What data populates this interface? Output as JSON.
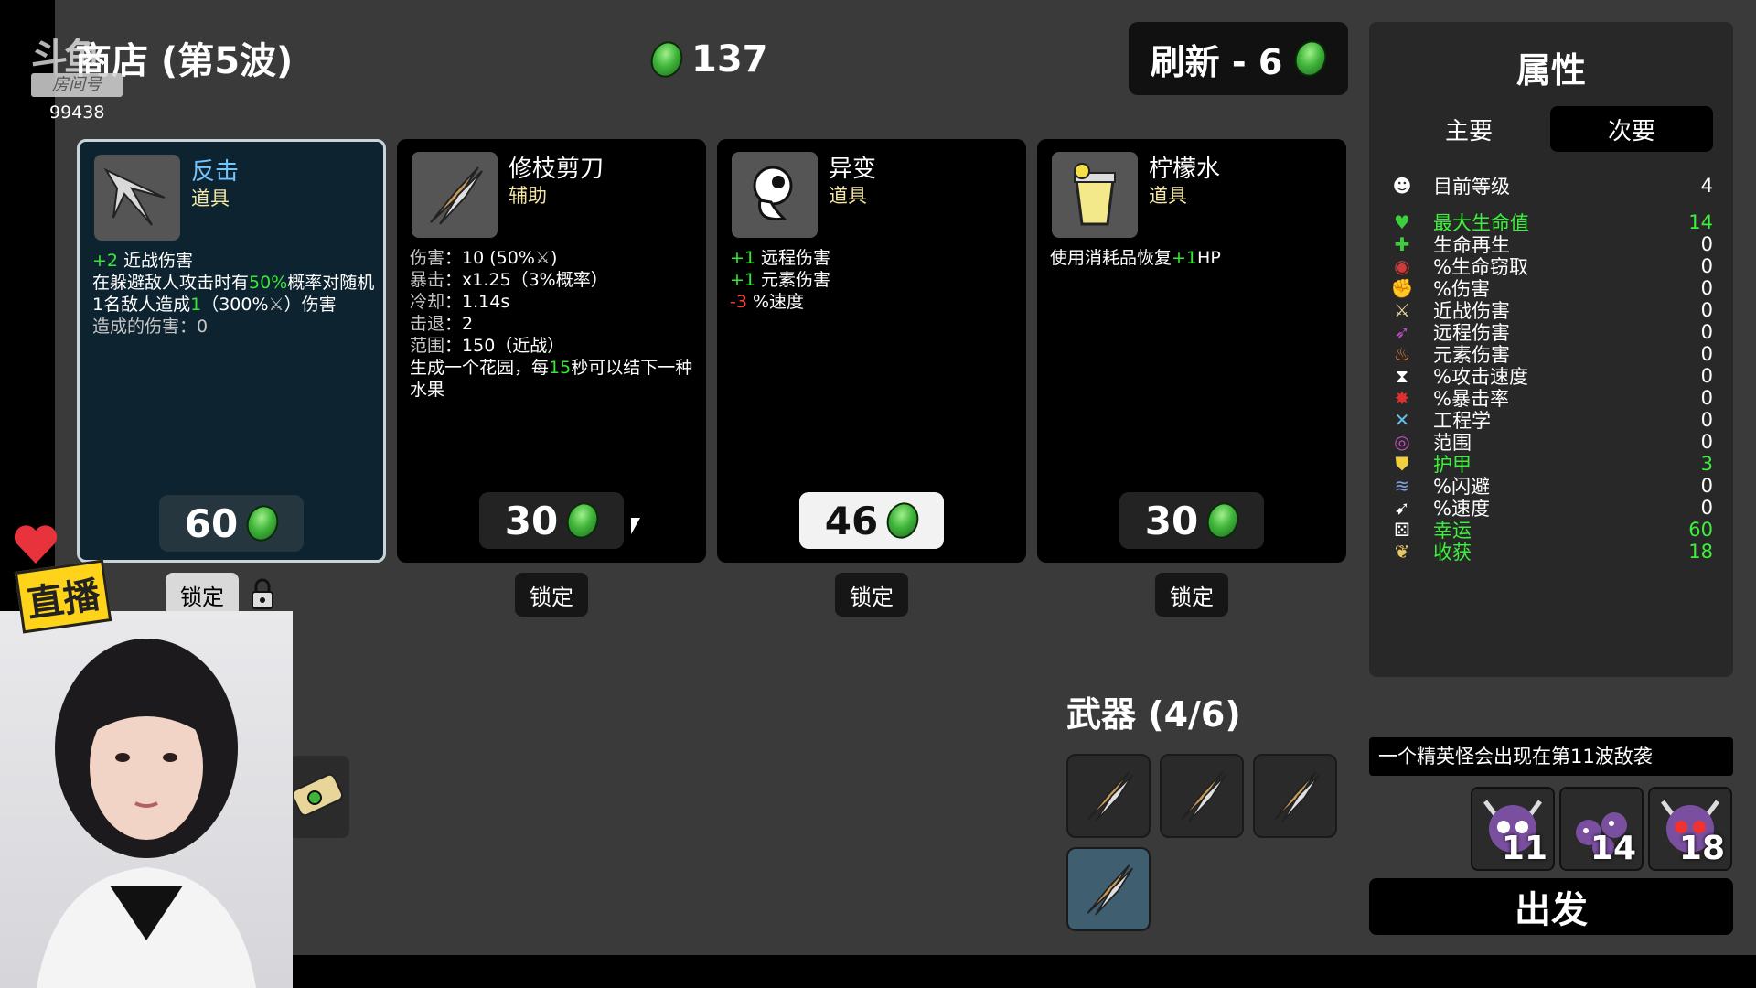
{
  "shop": {
    "title": "商店 (第5波)",
    "gold": "137",
    "reroll_label": "刷新 - 6",
    "lock_label": "锁定"
  },
  "watermark": {
    "logo": "斗鱼",
    "room_label": "房间号",
    "room_number": "99438"
  },
  "cards": [
    {
      "name": "反击",
      "type": "道具",
      "price": "60",
      "lines": [
        [
          {
            "t": "+2",
            "c": "g"
          },
          {
            "t": " 近战伤害"
          }
        ],
        [
          {
            "t": "在躲避敌人攻击时有"
          },
          {
            "t": "50%",
            "c": "g"
          },
          {
            "t": "概率对随机"
          }
        ],
        [
          {
            "t": "1名敌人造成"
          },
          {
            "t": "1",
            "c": "g"
          },
          {
            "t": "（300%"
          },
          {
            "t": "⚔",
            "c": "gr"
          },
          {
            "t": "）伤害"
          }
        ],
        [
          {
            "t": "造成的伤害：0",
            "c": "gr"
          }
        ]
      ]
    },
    {
      "name": "修枝剪刀",
      "type": "辅助",
      "price": "30",
      "lines": [
        [
          {
            "t": "伤害",
            "c": "gr"
          },
          {
            "t": "：10 (50%"
          },
          {
            "t": "⚔",
            "c": "gr"
          },
          {
            "t": ")"
          }
        ],
        [
          {
            "t": "暴击",
            "c": "gr"
          },
          {
            "t": "：x1.25（3%概率）"
          }
        ],
        [
          {
            "t": "冷却",
            "c": "gr"
          },
          {
            "t": "：1.14s"
          }
        ],
        [
          {
            "t": "击退",
            "c": "gr"
          },
          {
            "t": "：2"
          }
        ],
        [
          {
            "t": "范围",
            "c": "gr"
          },
          {
            "t": "：150（近战）"
          }
        ],
        [
          {
            "t": "生成一个花园，每"
          },
          {
            "t": "15",
            "c": "g"
          },
          {
            "t": "秒可以结下一种"
          }
        ],
        [
          {
            "t": "水果"
          }
        ]
      ]
    },
    {
      "name": "异变",
      "type": "道具",
      "price": "46",
      "lines": [
        [
          {
            "t": "+1",
            "c": "g"
          },
          {
            "t": " 远程伤害"
          }
        ],
        [
          {
            "t": "+1",
            "c": "g"
          },
          {
            "t": " 元素伤害"
          }
        ],
        [
          {
            "t": "-3",
            "c": "r"
          },
          {
            "t": " %速度"
          }
        ]
      ]
    },
    {
      "name": "柠檬水",
      "type": "道具",
      "price": "30",
      "lines": [
        [
          {
            "t": "使用消耗品恢复"
          },
          {
            "t": "+1",
            "c": "g"
          },
          {
            "t": "HP"
          }
        ]
      ]
    }
  ],
  "stats_panel": {
    "title": "属性",
    "tab_primary": "主要",
    "tab_secondary": "次要",
    "rows": [
      {
        "label": "目前等级",
        "value": "4",
        "icon": "level-icon",
        "glyph": "☻",
        "color": "#ffffff",
        "hl": false
      },
      {
        "label": "最大生命值",
        "value": "14",
        "icon": "heart-icon",
        "glyph": "♥",
        "color": "#3cd03c",
        "hl": true
      },
      {
        "label": "生命再生",
        "value": "0",
        "icon": "regen-icon",
        "glyph": "✚",
        "color": "#3cd03c",
        "hl": false
      },
      {
        "label": "%生命窃取",
        "value": "0",
        "icon": "lifesteal-icon",
        "glyph": "◉",
        "color": "#d03a3a",
        "hl": false
      },
      {
        "label": "%伤害",
        "value": "0",
        "icon": "damage-icon",
        "glyph": "✊",
        "color": "#d04a4a",
        "hl": false
      },
      {
        "label": "近战伤害",
        "value": "0",
        "icon": "melee-icon",
        "glyph": "⚔",
        "color": "#e8d59a",
        "hl": false
      },
      {
        "label": "远程伤害",
        "value": "0",
        "icon": "ranged-icon",
        "glyph": "➶",
        "color": "#c04ac8",
        "hl": false
      },
      {
        "label": "元素伤害",
        "value": "0",
        "icon": "elemental-icon",
        "glyph": "♨",
        "color": "#f08040",
        "hl": false
      },
      {
        "label": "%攻击速度",
        "value": "0",
        "icon": "attack-speed-icon",
        "glyph": "⧗",
        "color": "#ffffff",
        "hl": false
      },
      {
        "label": "%暴击率",
        "value": "0",
        "icon": "crit-icon",
        "glyph": "✸",
        "color": "#e03030",
        "hl": false
      },
      {
        "label": "工程学",
        "value": "0",
        "icon": "engineering-icon",
        "glyph": "✕",
        "color": "#60c0e8",
        "hl": false
      },
      {
        "label": "范围",
        "value": "0",
        "icon": "range-icon",
        "glyph": "◎",
        "color": "#c050c0",
        "hl": false
      },
      {
        "label": "护甲",
        "value": "3",
        "icon": "armor-icon",
        "glyph": "⛊",
        "color": "#f0d040",
        "hl": true
      },
      {
        "label": "%闪避",
        "value": "0",
        "icon": "dodge-icon",
        "glyph": "≋",
        "color": "#80a0e0",
        "hl": false
      },
      {
        "label": "%速度",
        "value": "0",
        "icon": "speed-icon",
        "glyph": "➹",
        "color": "#ffffff",
        "hl": false
      },
      {
        "label": "幸运",
        "value": "60",
        "icon": "luck-icon",
        "glyph": "⚄",
        "color": "#ffffff",
        "hl": true
      },
      {
        "label": "收获",
        "value": "18",
        "icon": "harvest-icon",
        "glyph": "❦",
        "color": "#e8c860",
        "hl": true
      }
    ]
  },
  "weapons": {
    "title": "武器 (4/6)"
  },
  "notice": "一个精英怪会出现在第11波敌袭",
  "danger_waves": [
    "11",
    "14",
    "18"
  ],
  "start_label": "出发",
  "overlay": {
    "live_sticker": "直播"
  },
  "colors": {
    "background": "#3a3a3a",
    "highlight_green": "#3cf03c",
    "material_green": "#3fb43a",
    "selected_card": "#0e2330"
  }
}
